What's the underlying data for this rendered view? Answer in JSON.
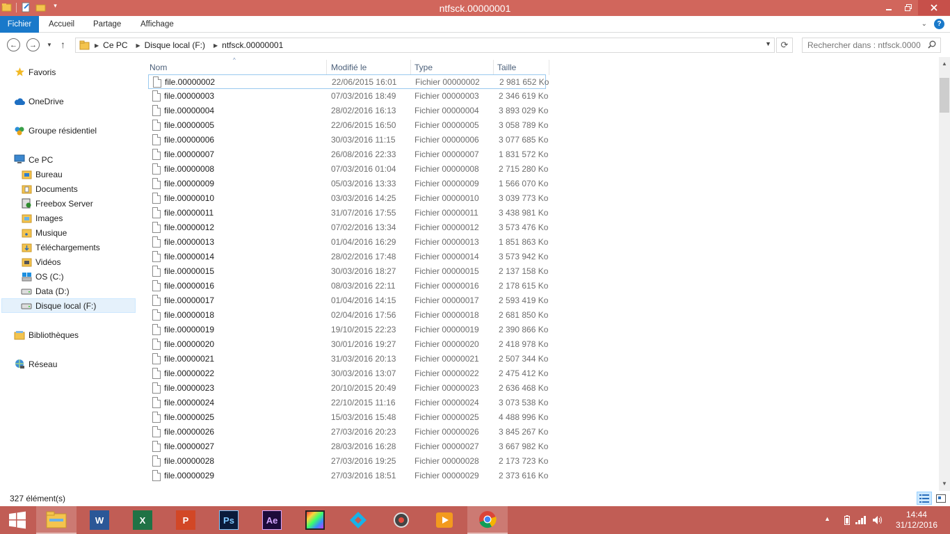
{
  "window": {
    "title": "ntfsck.00000001"
  },
  "ribbon": {
    "tabs": [
      {
        "label": "Fichier"
      },
      {
        "label": "Accueil"
      },
      {
        "label": "Partage"
      },
      {
        "label": "Affichage"
      }
    ],
    "help_label": "?"
  },
  "address": {
    "crumbs": [
      "Ce PC",
      "Disque local (F:)",
      "ntfsck.00000001"
    ]
  },
  "search": {
    "placeholder": "Rechercher dans : ntfsck.0000..."
  },
  "nav": {
    "favoris": "Favoris",
    "onedrive": "OneDrive",
    "groupe": "Groupe résidentiel",
    "cepc": "Ce PC",
    "children": [
      "Bureau",
      "Documents",
      "Freebox Server",
      "Images",
      "Musique",
      "Téléchargements",
      "Vidéos",
      "OS (C:)",
      "Data (D:)",
      "Disque local (F:)"
    ],
    "bibliotheques": "Bibliothèques",
    "reseau": "Réseau"
  },
  "columns": {
    "name": "Nom",
    "date": "Modifié le",
    "type": "Type",
    "size": "Taille"
  },
  "files": [
    {
      "name": "file.00000002",
      "date": "22/06/2015 16:01",
      "type": "Fichier 00000002",
      "size": "2 981 652 Ko"
    },
    {
      "name": "file.00000003",
      "date": "07/03/2016 18:49",
      "type": "Fichier 00000003",
      "size": "2 346 619 Ko"
    },
    {
      "name": "file.00000004",
      "date": "28/02/2016 16:13",
      "type": "Fichier 00000004",
      "size": "3 893 029 Ko"
    },
    {
      "name": "file.00000005",
      "date": "22/06/2015 16:50",
      "type": "Fichier 00000005",
      "size": "3 058 789 Ko"
    },
    {
      "name": "file.00000006",
      "date": "30/03/2016 11:15",
      "type": "Fichier 00000006",
      "size": "3 077 685 Ko"
    },
    {
      "name": "file.00000007",
      "date": "26/08/2016 22:33",
      "type": "Fichier 00000007",
      "size": "1 831 572 Ko"
    },
    {
      "name": "file.00000008",
      "date": "07/03/2016 01:04",
      "type": "Fichier 00000008",
      "size": "2 715 280 Ko"
    },
    {
      "name": "file.00000009",
      "date": "05/03/2016 13:33",
      "type": "Fichier 00000009",
      "size": "1 566 070 Ko"
    },
    {
      "name": "file.00000010",
      "date": "03/03/2016 14:25",
      "type": "Fichier 00000010",
      "size": "3 039 773 Ko"
    },
    {
      "name": "file.00000011",
      "date": "31/07/2016 17:55",
      "type": "Fichier 00000011",
      "size": "3 438 981 Ko"
    },
    {
      "name": "file.00000012",
      "date": "07/02/2016 13:34",
      "type": "Fichier 00000012",
      "size": "3 573 476 Ko"
    },
    {
      "name": "file.00000013",
      "date": "01/04/2016 16:29",
      "type": "Fichier 00000013",
      "size": "1 851 863 Ko"
    },
    {
      "name": "file.00000014",
      "date": "28/02/2016 17:48",
      "type": "Fichier 00000014",
      "size": "3 573 942 Ko"
    },
    {
      "name": "file.00000015",
      "date": "30/03/2016 18:27",
      "type": "Fichier 00000015",
      "size": "2 137 158 Ko"
    },
    {
      "name": "file.00000016",
      "date": "08/03/2016 22:11",
      "type": "Fichier 00000016",
      "size": "2 178 615 Ko"
    },
    {
      "name": "file.00000017",
      "date": "01/04/2016 14:15",
      "type": "Fichier 00000017",
      "size": "2 593 419 Ko"
    },
    {
      "name": "file.00000018",
      "date": "02/04/2016 17:56",
      "type": "Fichier 00000018",
      "size": "2 681 850 Ko"
    },
    {
      "name": "file.00000019",
      "date": "19/10/2015 22:23",
      "type": "Fichier 00000019",
      "size": "2 390 866 Ko"
    },
    {
      "name": "file.00000020",
      "date": "30/01/2016 19:27",
      "type": "Fichier 00000020",
      "size": "2 418 978 Ko"
    },
    {
      "name": "file.00000021",
      "date": "31/03/2016 20:13",
      "type": "Fichier 00000021",
      "size": "2 507 344 Ko"
    },
    {
      "name": "file.00000022",
      "date": "30/03/2016 13:07",
      "type": "Fichier 00000022",
      "size": "2 475 412 Ko"
    },
    {
      "name": "file.00000023",
      "date": "20/10/2015 20:49",
      "type": "Fichier 00000023",
      "size": "2 636 468 Ko"
    },
    {
      "name": "file.00000024",
      "date": "22/10/2015 11:16",
      "type": "Fichier 00000024",
      "size": "3 073 538 Ko"
    },
    {
      "name": "file.00000025",
      "date": "15/03/2016 15:48",
      "type": "Fichier 00000025",
      "size": "4 488 996 Ko"
    },
    {
      "name": "file.00000026",
      "date": "27/03/2016 20:23",
      "type": "Fichier 00000026",
      "size": "3 845 267 Ko"
    },
    {
      "name": "file.00000027",
      "date": "28/03/2016 16:28",
      "type": "Fichier 00000027",
      "size": "3 667 982 Ko"
    },
    {
      "name": "file.00000028",
      "date": "27/03/2016 19:25",
      "type": "Fichier 00000028",
      "size": "2 173 723 Ko"
    },
    {
      "name": "file.00000029",
      "date": "27/03/2016 18:51",
      "type": "Fichier 00000029",
      "size": "2 373 616 Ko"
    }
  ],
  "status": {
    "count": "327 élément(s)"
  },
  "taskbar": {
    "apps": [
      "windows-start",
      "file-explorer",
      "word",
      "excel",
      "powerpoint",
      "photoshop",
      "after-effects",
      "media-app",
      "kodi",
      "vlc-or-tool",
      "video-player",
      "chrome"
    ],
    "time": "14:44",
    "date": "31/12/2016"
  },
  "colors": {
    "titlebar": "#d1665c",
    "taskbar": "#c15d55",
    "file_tab": "#1979ca",
    "selection": "#e5f1fb"
  }
}
